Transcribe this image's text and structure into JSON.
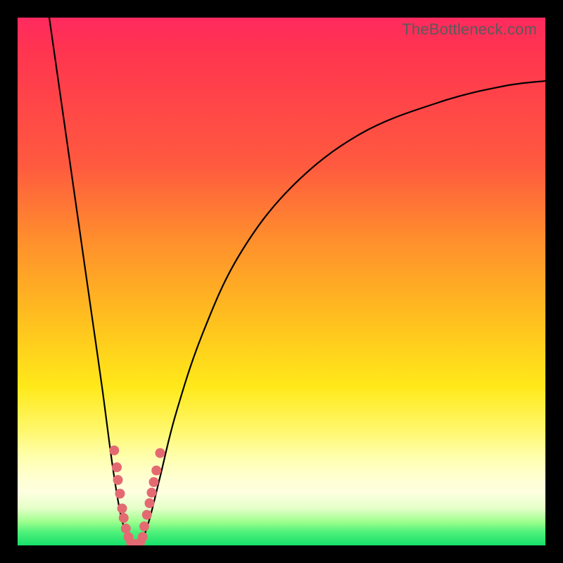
{
  "watermark": "TheBottleneck.com",
  "chart_data": {
    "type": "line",
    "title": "",
    "xlabel": "",
    "ylabel": "",
    "xlim": [
      0,
      100
    ],
    "ylim": [
      0,
      100
    ],
    "grid": false,
    "legend": false,
    "series": [
      {
        "name": "left-curve",
        "x": [
          6,
          8,
          10,
          12,
          14,
          16,
          18,
          19.5,
          21,
          22
        ],
        "y": [
          100,
          86,
          72,
          58,
          44,
          30,
          15,
          6,
          1,
          0
        ]
      },
      {
        "name": "right-curve",
        "x": [
          22,
          23.5,
          25,
          27,
          30,
          35,
          42,
          52,
          65,
          80,
          92,
          100
        ],
        "y": [
          0,
          1,
          5,
          13,
          25,
          40,
          55,
          68,
          78,
          84,
          87,
          88
        ]
      }
    ],
    "markers": [
      {
        "name": "left-dot",
        "x": 18.3,
        "y": 18.0
      },
      {
        "name": "left-dot",
        "x": 18.8,
        "y": 14.8
      },
      {
        "name": "left-dot",
        "x": 19.0,
        "y": 12.4
      },
      {
        "name": "left-dot",
        "x": 19.4,
        "y": 9.8
      },
      {
        "name": "left-dot",
        "x": 19.8,
        "y": 7.0
      },
      {
        "name": "left-dot",
        "x": 20.1,
        "y": 5.2
      },
      {
        "name": "left-dot",
        "x": 20.5,
        "y": 3.2
      },
      {
        "name": "left-dot",
        "x": 21.0,
        "y": 1.6
      },
      {
        "name": "bottom-dot",
        "x": 21.5,
        "y": 0.5
      },
      {
        "name": "bottom-dot",
        "x": 22.0,
        "y": 0.2
      },
      {
        "name": "bottom-dot",
        "x": 22.6,
        "y": 0.2
      },
      {
        "name": "bottom-dot",
        "x": 23.2,
        "y": 0.5
      },
      {
        "name": "right-dot",
        "x": 23.7,
        "y": 1.6
      },
      {
        "name": "right-dot",
        "x": 24.0,
        "y": 3.6
      },
      {
        "name": "right-dot",
        "x": 24.5,
        "y": 5.8
      },
      {
        "name": "right-dot",
        "x": 25.0,
        "y": 8.0
      },
      {
        "name": "right-dot",
        "x": 25.4,
        "y": 10.0
      },
      {
        "name": "right-dot",
        "x": 25.8,
        "y": 12.0
      },
      {
        "name": "right-dot",
        "x": 26.3,
        "y": 14.2
      },
      {
        "name": "right-dot",
        "x": 27.0,
        "y": 17.5
      }
    ],
    "marker_style": {
      "color": "#e46a72",
      "radius_px": 7
    }
  }
}
